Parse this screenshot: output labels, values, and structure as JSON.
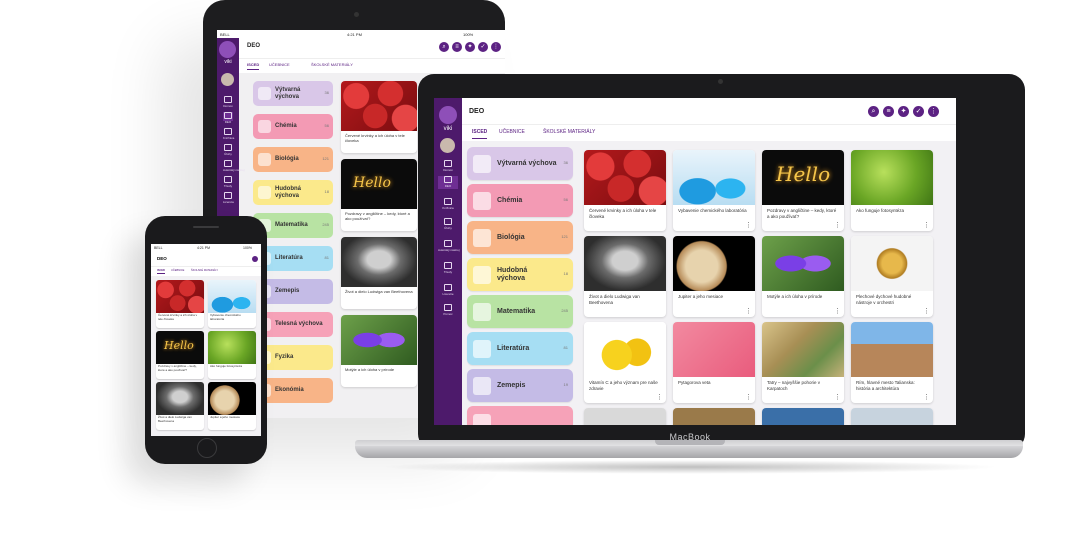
{
  "app": {
    "brand": "viki",
    "page_title": "DEO",
    "tabs": [
      "ISCED",
      "UČEBNICE",
      "ŠKOLSKÉ MATERIÁLY"
    ],
    "active_tab": "ISCED",
    "header_buttons": [
      "search-icon",
      "filter-icon",
      "network-icon",
      "check-icon",
      "more-icon"
    ],
    "accent_color": "#5c2283",
    "sidebar_color": "#4d1a6b"
  },
  "sidebar": {
    "items": [
      {
        "label": "Domov",
        "icon": "home-icon"
      },
      {
        "label": "DEO",
        "icon": "grid-icon"
      },
      {
        "label": "Knižnica",
        "icon": "book-icon"
      },
      {
        "label": "Úlohy",
        "icon": "task-icon"
      },
      {
        "label": "Autorský nástroj",
        "icon": "palette-icon"
      },
      {
        "label": "Triedy",
        "icon": "group-icon"
      },
      {
        "label": "Licencie",
        "icon": "license-icon"
      },
      {
        "label": "Pomoc",
        "icon": "help-icon"
      }
    ]
  },
  "status_bar": {
    "carrier": "BELL",
    "time": "4:21 PM",
    "battery": "100%"
  },
  "subjects": [
    {
      "name": "Výtvarná výchova",
      "count": "36",
      "color": "#d9c7e8",
      "icon": "palette-icon"
    },
    {
      "name": "Chémia",
      "count": "56",
      "color": "#f39ab4",
      "icon": "lab-icon"
    },
    {
      "name": "Biológia",
      "count": "121",
      "color": "#f8b487",
      "icon": "dna-icon"
    },
    {
      "name": "Hudobná výchova",
      "count": "18",
      "color": "#fbe98b",
      "icon": "music-icon"
    },
    {
      "name": "Matematika",
      "count": "245",
      "color": "#b8e3a3",
      "icon": "calculator-icon"
    },
    {
      "name": "Literatúra",
      "count": "81",
      "color": "#a6def3",
      "icon": "book-icon"
    },
    {
      "name": "Zemepis",
      "count": "19",
      "color": "#c4bbe6",
      "icon": "globe-icon"
    },
    {
      "name": "Telesná výchova",
      "count": "",
      "color": "#f6a2b8",
      "icon": "sport-icon"
    },
    {
      "name": "Fyzika",
      "count": "",
      "color": "#fbe98b",
      "icon": "physics-icon"
    },
    {
      "name": "Ekonómia",
      "count": "",
      "color": "#f8b487",
      "icon": "money-icon"
    }
  ],
  "cards": [
    {
      "caption": "Červené krvinky a ich úloha v tele človeka",
      "image": "blood-cells"
    },
    {
      "caption": "Vybavenie chemického laboratória",
      "image": "lab-glassware"
    },
    {
      "caption": "Pozdravy v angličtine – kedy, ktoré a ako používať?",
      "image": "neon-hello"
    },
    {
      "caption": "Ako funguje fotosyntéza",
      "image": "green-leaf"
    },
    {
      "caption": "Život a dielo Ludwiga van Beethovena",
      "image": "beethoven"
    },
    {
      "caption": "Jupiter a jeho mesiace",
      "image": "jupiter"
    },
    {
      "caption": "Motýle a ich úloha v prírode",
      "image": "butterfly"
    },
    {
      "caption": "Plechové dychové hudobné nástroje v orchestri",
      "image": "french-horn"
    },
    {
      "caption": "Vitamín C a jeho význam pre naše zdravie",
      "image": "lemons"
    },
    {
      "caption": "Pytagorova veta",
      "image": "pythagoras"
    },
    {
      "caption": "Tatry – najvyššie pohorie v Karpatoch",
      "image": "relief-map"
    },
    {
      "caption": "Rím, hlavné mesto Talianska: história a architektúra",
      "image": "colosseum"
    }
  ],
  "devices": {
    "laptop_brand": "MacBook"
  }
}
